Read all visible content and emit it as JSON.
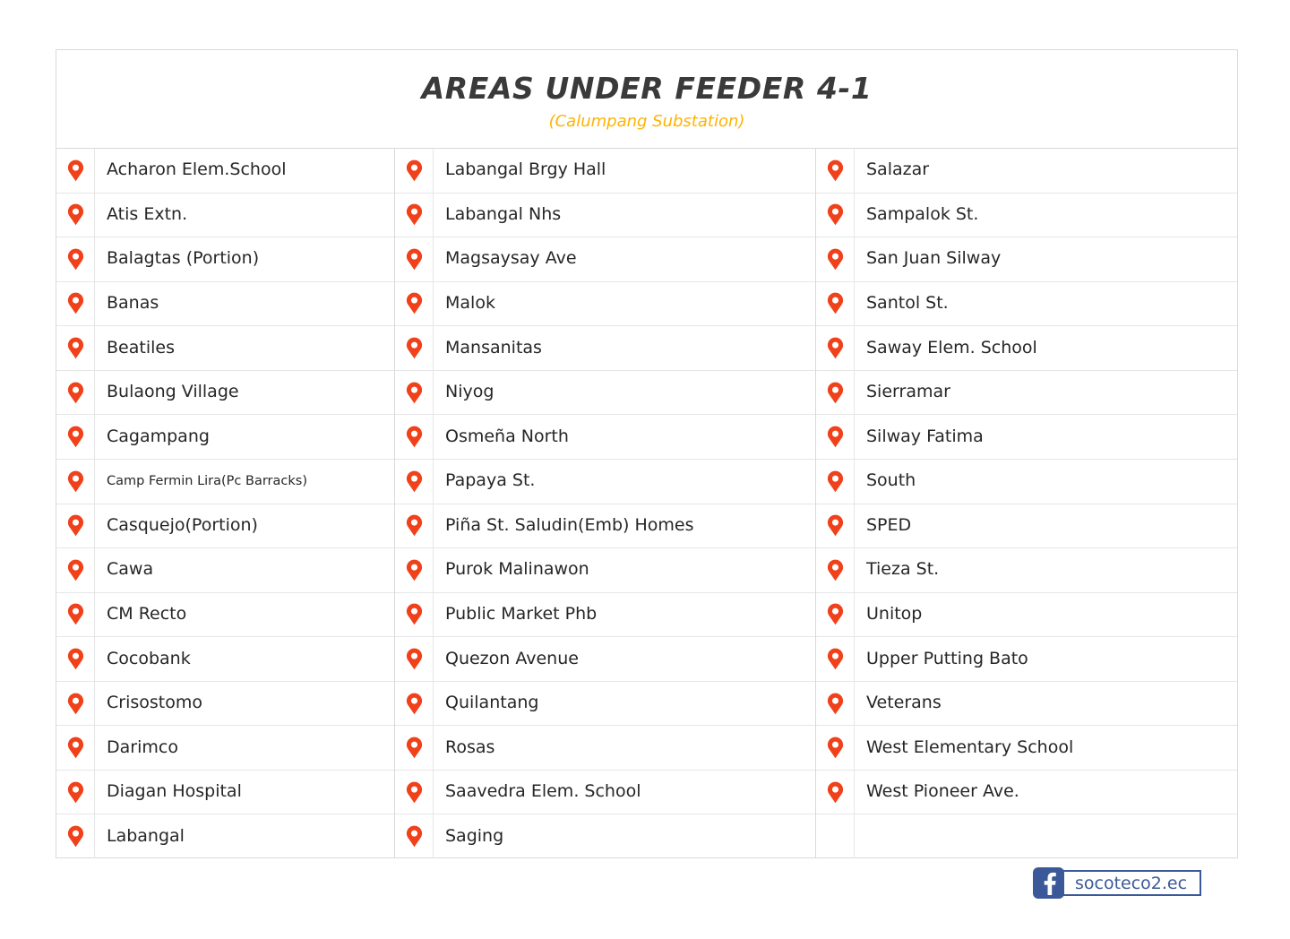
{
  "header": {
    "title": "AREAS UNDER FEEDER 4-1",
    "subtitle": "(Calumpang Substation)"
  },
  "colors": {
    "pin": "#f0411a",
    "title": "#3a3a3a",
    "subtitle": "#ffb300",
    "facebook": "#3b5998",
    "border": "#d9d9d9",
    "row_border": "#e6e6e6",
    "background": "#ffffff"
  },
  "icons": {
    "pin": "map-pin-icon",
    "facebook": "facebook-icon"
  },
  "columns": [
    {
      "name": "column-1",
      "items": [
        {
          "label": "Acharon Elem.School",
          "small": false
        },
        {
          "label": "Atis Extn.",
          "small": false
        },
        {
          "label": "Balagtas (Portion)",
          "small": false
        },
        {
          "label": "Banas",
          "small": false
        },
        {
          "label": "Beatiles",
          "small": false
        },
        {
          "label": "Bulaong Village",
          "small": false
        },
        {
          "label": "Cagampang",
          "small": false
        },
        {
          "label": "Camp Fermin Lira(Pc Barracks)",
          "small": true
        },
        {
          "label": "Casquejo(Portion)",
          "small": false
        },
        {
          "label": "Cawa",
          "small": false
        },
        {
          "label": "CM Recto",
          "small": false
        },
        {
          "label": "Cocobank",
          "small": false
        },
        {
          "label": "Crisostomo",
          "small": false
        },
        {
          "label": "Darimco",
          "small": false
        },
        {
          "label": "Diagan Hospital",
          "small": false
        },
        {
          "label": "Labangal",
          "small": false
        }
      ]
    },
    {
      "name": "column-2",
      "items": [
        {
          "label": "Labangal Brgy Hall",
          "small": false
        },
        {
          "label": "Labangal Nhs",
          "small": false
        },
        {
          "label": "Magsaysay Ave",
          "small": false
        },
        {
          "label": "Malok",
          "small": false
        },
        {
          "label": "Mansanitas",
          "small": false
        },
        {
          "label": "Niyog",
          "small": false
        },
        {
          "label": "Osmeña North",
          "small": false
        },
        {
          "label": "Papaya St.",
          "small": false
        },
        {
          "label": "Piña St. Saludin(Emb) Homes",
          "small": false
        },
        {
          "label": "Purok Malinawon",
          "small": false
        },
        {
          "label": "Public Market Phb",
          "small": false
        },
        {
          "label": "Quezon Avenue",
          "small": false
        },
        {
          "label": "Quilantang",
          "small": false
        },
        {
          "label": "Rosas",
          "small": false
        },
        {
          "label": "Saavedra Elem. School",
          "small": false
        },
        {
          "label": "Saging",
          "small": false
        }
      ]
    },
    {
      "name": "column-3",
      "items": [
        {
          "label": "Salazar",
          "small": false
        },
        {
          "label": "Sampalok St.",
          "small": false
        },
        {
          "label": "San Juan Silway",
          "small": false
        },
        {
          "label": "Santol St.",
          "small": false
        },
        {
          "label": "Saway Elem. School",
          "small": false
        },
        {
          "label": "Sierramar",
          "small": false
        },
        {
          "label": "Silway Fatima",
          "small": false
        },
        {
          "label": "South",
          "small": false
        },
        {
          "label": "SPED",
          "small": false
        },
        {
          "label": "Tieza St.",
          "small": false
        },
        {
          "label": "Unitop",
          "small": false
        },
        {
          "label": "Upper Putting Bato",
          "small": false
        },
        {
          "label": "Veterans",
          "small": false
        },
        {
          "label": "West Elementary School",
          "small": false
        },
        {
          "label": "West Pioneer Ave.",
          "small": false
        },
        {
          "label": "",
          "small": false
        }
      ]
    }
  ],
  "footer": {
    "facebook_url": "socoteco2.ec"
  }
}
